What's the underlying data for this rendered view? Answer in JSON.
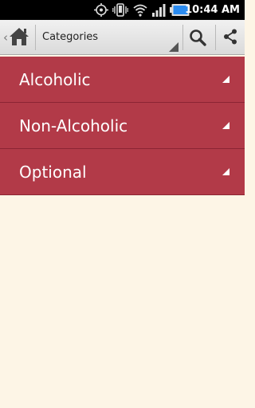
{
  "status_bar": {
    "time": "10:44 AM",
    "icons": [
      "gps-icon",
      "vibrate-icon",
      "wifi-icon",
      "signal-icon",
      "battery-icon"
    ]
  },
  "action_bar": {
    "spinner_label": "Categories",
    "icons": [
      "chevron-left-icon",
      "home-icon",
      "search-icon",
      "share-icon"
    ]
  },
  "categories": [
    {
      "label": "Alcoholic"
    },
    {
      "label": "Non-Alcoholic"
    },
    {
      "label": "Optional"
    }
  ],
  "colors": {
    "category_background": "#b23a48",
    "content_background": "#fdf5e6",
    "action_bar": "#e6e6e6"
  }
}
